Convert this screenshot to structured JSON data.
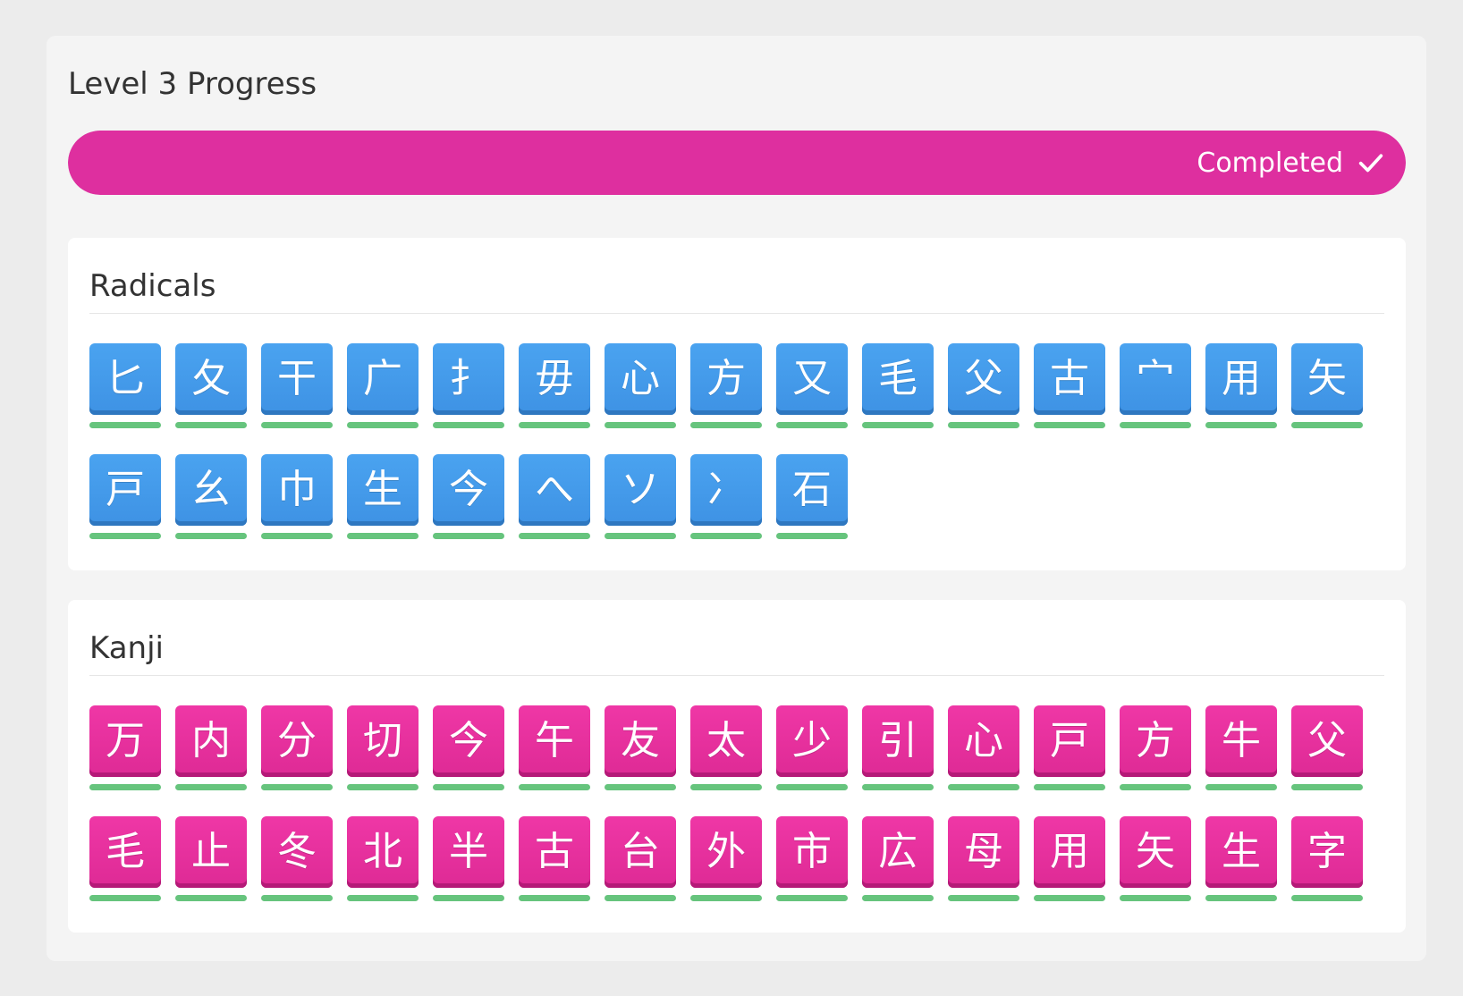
{
  "level": {
    "title": "Level 3 Progress",
    "progress_percent": 100,
    "progress_label": "Completed",
    "progress_color": "#de2f9f"
  },
  "colors": {
    "radical": "#4399ea",
    "kanji": "#e32f9e",
    "srs_bar": "#66c47d"
  },
  "radicals": {
    "title": "Radicals",
    "items": [
      "匕",
      "夂",
      "干",
      "广",
      "扌",
      "毋",
      "心",
      "方",
      "又",
      "毛",
      "父",
      "古",
      "宀",
      "用",
      "矢",
      "戸",
      "幺",
      "巾",
      "生",
      "今",
      "へ",
      "ソ",
      "冫",
      "石"
    ]
  },
  "kanji": {
    "title": "Kanji",
    "items": [
      "万",
      "内",
      "分",
      "切",
      "今",
      "午",
      "友",
      "太",
      "少",
      "引",
      "心",
      "戸",
      "方",
      "牛",
      "父",
      "毛",
      "止",
      "冬",
      "北",
      "半",
      "古",
      "台",
      "外",
      "市",
      "広",
      "母",
      "用",
      "矢",
      "生",
      "字"
    ]
  }
}
